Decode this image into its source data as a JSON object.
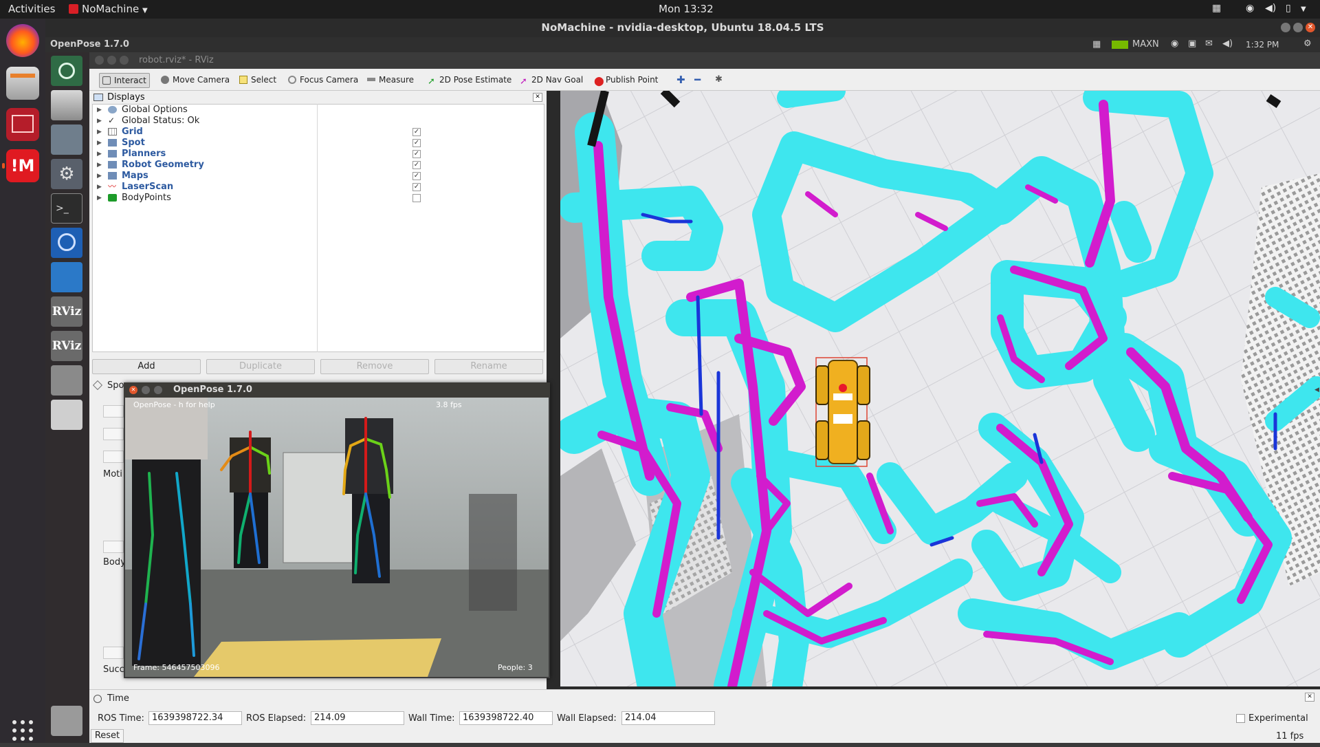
{
  "topbar": {
    "activities": "Activities",
    "app_menu": "NoMachine",
    "clock": "Mon 13:32"
  },
  "nomachine": {
    "title": "NoMachine - nvidia-desktop, Ubuntu 18.04.5 LTS",
    "remote_app": "OpenPose 1.7.0",
    "remote_power_mode": "MAXN",
    "remote_time": "1:32 PM"
  },
  "rviz": {
    "title": "robot.rviz* - RViz",
    "toolbar": {
      "interact": "Interact",
      "move_camera": "Move Camera",
      "select": "Select",
      "focus_camera": "Focus Camera",
      "measure": "Measure",
      "pose_estimate": "2D Pose Estimate",
      "nav_goal": "2D Nav Goal",
      "publish_point": "Publish Point"
    },
    "displays": {
      "header": "Displays",
      "items": [
        {
          "label": "Global Options",
          "checked": null,
          "icon": "gear-icon"
        },
        {
          "label": "Global Status: Ok",
          "checked": null,
          "icon": "checkmark-icon"
        },
        {
          "label": "Grid",
          "checked": true,
          "icon": "grid-icon"
        },
        {
          "label": "Spot",
          "checked": true,
          "icon": "folder-icon"
        },
        {
          "label": "Planners",
          "checked": true,
          "icon": "folder-icon"
        },
        {
          "label": "Robot Geometry",
          "checked": true,
          "icon": "folder-icon"
        },
        {
          "label": "Maps",
          "checked": true,
          "icon": "folder-icon"
        },
        {
          "label": "LaserScan",
          "checked": true,
          "icon": "laserscan-icon"
        },
        {
          "label": "BodyPoints",
          "checked": false,
          "icon": "green-cube-icon"
        }
      ],
      "buttons": {
        "add": "Add",
        "duplicate": "Duplicate",
        "remove": "Remove",
        "rename": "Rename"
      }
    },
    "spot_panel": {
      "title": "Spo",
      "motion_label": "Moti",
      "body_label": "Body",
      "success_label": "Succ"
    },
    "time": {
      "header": "Time",
      "ros_time_label": "ROS Time:",
      "ros_time": "1639398722.34",
      "ros_elapsed_label": "ROS Elapsed:",
      "ros_elapsed": "214.09",
      "wall_time_label": "Wall Time:",
      "wall_time": "1639398722.40",
      "wall_elapsed_label": "Wall Elapsed:",
      "wall_elapsed": "214.04",
      "experimental": "Experimental",
      "fps": "11 fps",
      "reset": "Reset"
    }
  },
  "openpose": {
    "title": "OpenPose 1.7.0",
    "help": "OpenPose - h for help",
    "fps": "3.8 fps",
    "frame": "Frame: 546457503096",
    "people": "People: 3"
  },
  "colors": {
    "cyan": "#3ee6ee",
    "magenta": "#d21ccd",
    "robot": "#f0b020"
  }
}
